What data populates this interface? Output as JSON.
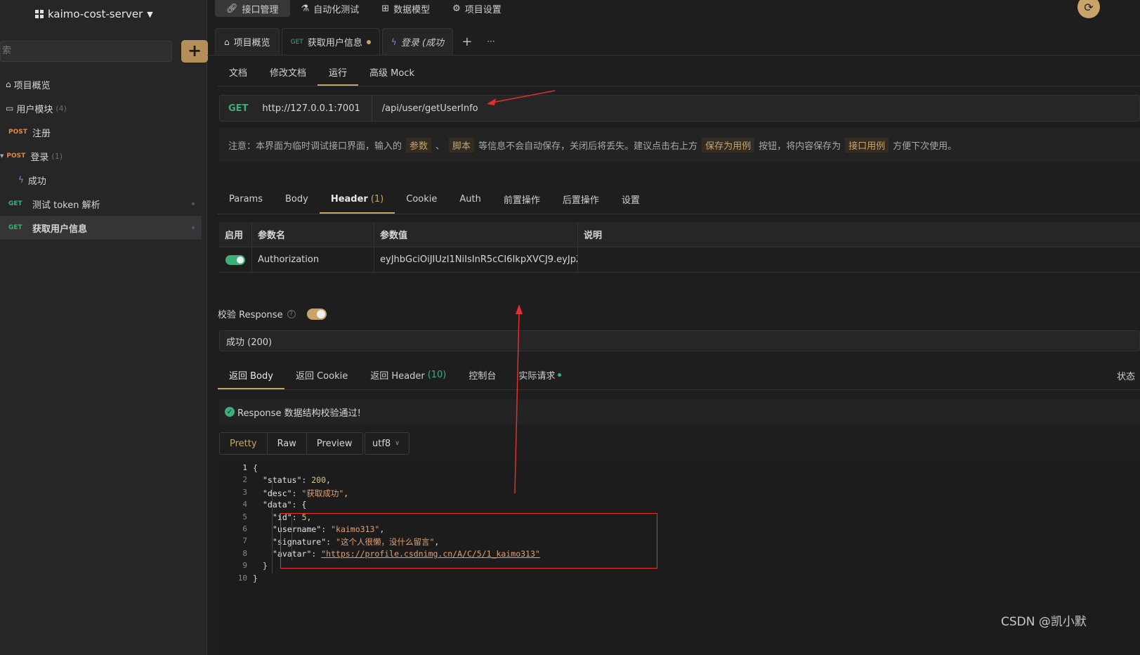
{
  "project": {
    "name": "kaimo-cost-server"
  },
  "sidebar": {
    "search_placeholder": "索",
    "items": [
      {
        "label": "项目概览",
        "method": "",
        "count": ""
      },
      {
        "label": "用户模块",
        "method": "",
        "count": "(4)"
      },
      {
        "label": "注册",
        "method": "POST",
        "count": ""
      },
      {
        "label": "登录",
        "method": "POST",
        "count": "(1)"
      },
      {
        "label": "成功",
        "method": "",
        "count": ""
      },
      {
        "label": "测试 token 解析",
        "method": "GET",
        "count": ""
      },
      {
        "label": "获取用户信息",
        "method": "GET",
        "count": ""
      }
    ]
  },
  "topnav": [
    "接口管理",
    "自动化测试",
    "数据模型",
    "项目设置"
  ],
  "tabs": [
    {
      "label": "项目概览",
      "method": ""
    },
    {
      "label": "获取用户信息",
      "method": "GET"
    },
    {
      "label": "登录 (成功",
      "method": ""
    }
  ],
  "tab_actions": {
    "add": "+",
    "more": "···"
  },
  "subtabs": [
    "文档",
    "修改文档",
    "运行",
    "高级 Mock"
  ],
  "url": {
    "method": "GET",
    "base": "http://127.0.0.1:7001",
    "path": "/api/user/getUserInfo"
  },
  "notice": {
    "prefix": "注意：本界面为临时调试接口界面，输入的",
    "tag1": "参数",
    "sep": "、",
    "tag2": "脚本",
    "middle": "等信息不会自动保存，关闭后将丢失。建议点击右上方",
    "tag3": "保存为用例",
    "middle2": "按钮，将内容保存为",
    "tag4": "接口用例",
    "suffix": "方便下次使用。"
  },
  "request_tabs": [
    "Params",
    "Body",
    "Header",
    "Cookie",
    "Auth",
    "前置操作",
    "后置操作",
    "设置"
  ],
  "header_count": "(1)",
  "header_table": {
    "columns": [
      "启用",
      "参数名",
      "参数值",
      "说明"
    ],
    "rows": [
      {
        "enabled": true,
        "name": "Authorization",
        "value": "eyJhbGciOiJIUzI1NiIsInR5cCI6IkpXVCJ9.eyJpZC",
        "desc": ""
      }
    ]
  },
  "validate": {
    "label": "校验 Response",
    "help": "?",
    "selected": "成功 (200)"
  },
  "response_tabs": [
    "返回 Body",
    "返回 Cookie",
    "返回 Header",
    "控制台",
    "实际请求"
  ],
  "response_header_count": "(10)",
  "status_label": "状态",
  "passed_message": "Response 数据结构校验通过!",
  "format_buttons": [
    "Pretty",
    "Raw",
    "Preview"
  ],
  "encoding": "utf8",
  "code": {
    "line_numbers": [
      "1",
      "2",
      "3",
      "4",
      "5",
      "6",
      "7",
      "8",
      "9",
      "10"
    ],
    "lines": [
      {
        "text": "{"
      },
      {
        "key": "\"status\"",
        "val": "200",
        "type": "n",
        "tail": ","
      },
      {
        "key": "\"desc\"",
        "val": "\"获取成功\"",
        "type": "s",
        "tail": ","
      },
      {
        "key": "\"data\"",
        "val": "{",
        "type": "p",
        "tail": ""
      },
      {
        "key": "\"id\"",
        "val": "5",
        "type": "n",
        "tail": ","
      },
      {
        "key": "\"username\"",
        "val": "\"kaimo313\"",
        "type": "s",
        "tail": ","
      },
      {
        "key": "\"signature\"",
        "val": "\"这个人很懒，没什么留言\"",
        "type": "s",
        "tail": ","
      },
      {
        "key": "\"avatar\"",
        "val": "\"https://profile.csdnimg.cn/A/C/5/1_kaimo313\"",
        "type": "u",
        "tail": ""
      },
      {
        "text": "}"
      },
      {
        "text": "}"
      }
    ]
  },
  "watermark": "CSDN @凯小默",
  "colors": {
    "accent": "#c9a46a",
    "get": "#3dae7a",
    "post": "#e08a4a",
    "annotation": "#e03030"
  }
}
